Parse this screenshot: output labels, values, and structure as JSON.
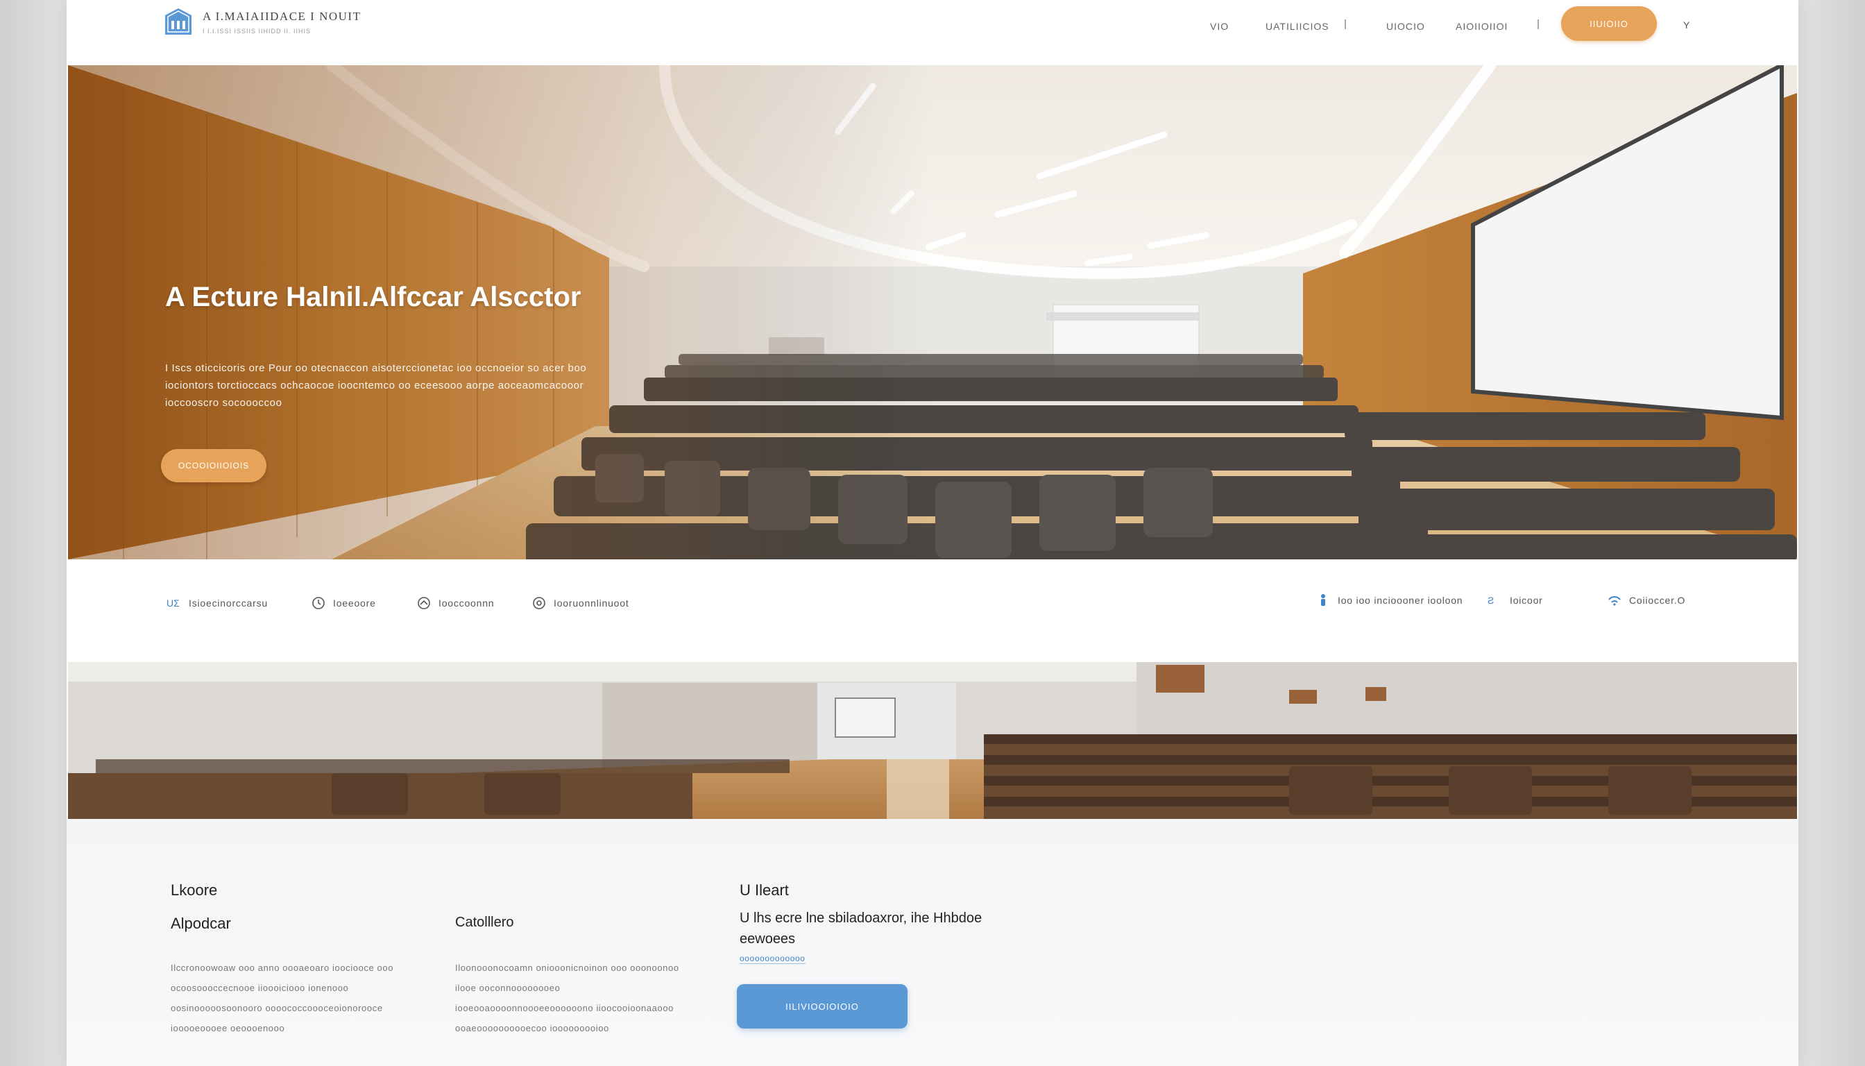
{
  "brand": {
    "name": "A I.MAIAIIDACE I NOUIT",
    "tagline": "I I.I.ISSI ISSIIS IIHIDD II. IIHIS",
    "logo_icon": "building-icon",
    "accent_color": "#e8a35a",
    "blue_color": "#5b98d6"
  },
  "nav": {
    "links": [
      "VIO",
      "UATILIICIOS",
      "UIOCIO",
      "AIOIIOIIOI"
    ],
    "cta_label": "IIUIOIIO",
    "menu_glyph": "Y"
  },
  "hero": {
    "title": "A Ecture Halnil.Alfccar Alscctor",
    "description": "I Iscs  oticcicoris ore Pour oo otecnaccon aisoterccionetac ioo occnoeior so acer boo iociontors torctioccacs ochcaocoe ioocntemco oo eceesooo aorpe aoceaomcacooor ioccooscro socoooccoo",
    "cta_label": "OCOOIOIIOIOIS"
  },
  "features_left": [
    {
      "icon": "accessibility-icon",
      "label": "Isioecinorccarsu"
    },
    {
      "icon": "clock-icon",
      "label": "Ioeeoore"
    },
    {
      "icon": "gauge-icon",
      "label": "Iooccoonnn"
    },
    {
      "icon": "refresh-icon",
      "label": "Iooruonnlinuoot"
    }
  ],
  "features_right": [
    {
      "icon": "person-icon",
      "label": "Ioo ioo incioooner iooloon"
    },
    {
      "icon": "link-icon",
      "label": "Ioicoor"
    },
    {
      "icon": "wifi-icon",
      "label": "Coiioccer.O"
    }
  ],
  "info": {
    "col1": {
      "kicker": "Lkoore",
      "heading": "Alpodcar",
      "body": "Ilccronoowoaw ooo anno oooaeoaro ioociooce ooo ocoosoooccecnooe iioooiciooo ionenooo oosinooooosoonooro oooococcoooceoionorooce iooooeoooee oeoooenooo"
    },
    "col2": {
      "heading": "Catolllero",
      "body": "Iloonooonocoamn oniooonicnoinon ooo ooonoonoo ilooe ooconnoooooooeo iooeooaoooonnoooeeoooooono iioocooioonaaooo ooaeoooooooooecoo iooooooooioo"
    },
    "cta": {
      "title": "U Ileart",
      "text": "U lhs ecre lne sbiladoaxror, ihe Hhbdoe eewoees",
      "link": "ooooooooooooo",
      "button_label": "IILIVIOOIOIOIO"
    }
  }
}
